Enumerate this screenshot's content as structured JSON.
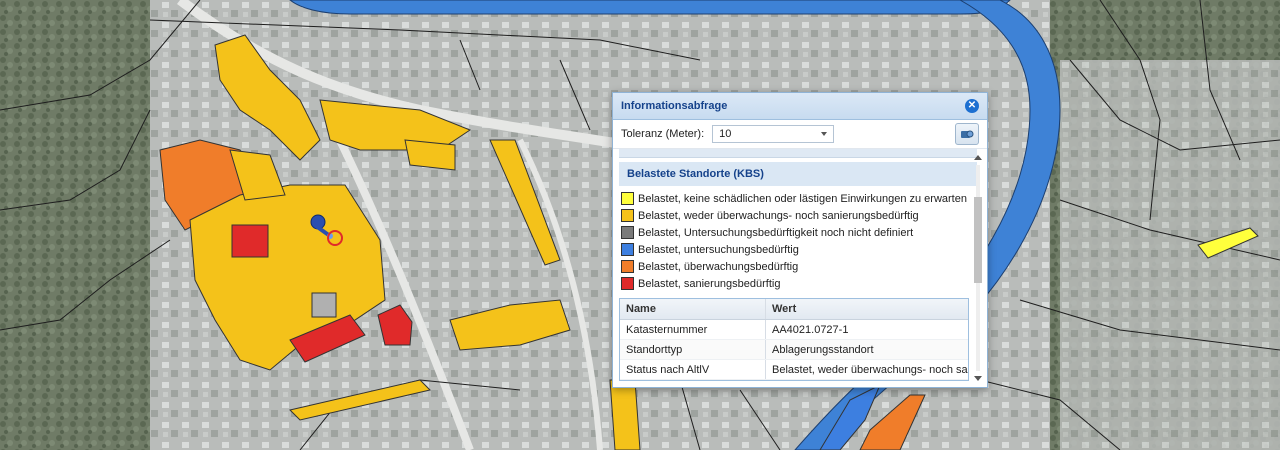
{
  "colors": {
    "river": "#3e82d6",
    "yellow": "#f6d21c",
    "orange_yellow": "#f4c21a",
    "grey": "#7a7a7a",
    "blue": "#3d7fe0",
    "orange": "#f07d2a",
    "red": "#e02a2a",
    "accent": "#15428b"
  },
  "dialog": {
    "title": "Informationsabfrage",
    "close_icon": "close-icon",
    "tolerance_label": "Toleranz (Meter):",
    "tolerance_value": "10",
    "tool_icon": "identify-tool-icon",
    "section_title": "Belastete Standorte (KBS)",
    "legend": [
      {
        "label": "Belastet, keine schädlichen oder lästigen Einwirkungen zu erwarten",
        "color": "#ffff3c"
      },
      {
        "label": "Belastet, weder überwachungs- noch sanierungsbedürftig",
        "color": "#f5c21b"
      },
      {
        "label": "Belastet, Untersuchungsbedürftigkeit noch nicht definiert",
        "color": "#7a7a7a"
      },
      {
        "label": "Belastet, untersuchungsbedürftig",
        "color": "#3d7fe0"
      },
      {
        "label": "Belastet, überwachungsbedürftig",
        "color": "#f07d2a"
      },
      {
        "label": "Belastet, sanierungsbedürftig",
        "color": "#e02a2a"
      }
    ],
    "table": {
      "headers": [
        "Name",
        "Wert"
      ],
      "rows": [
        [
          "Katasternummer",
          "AA4021.0727-1"
        ],
        [
          "Standorttyp",
          "Ablagerungsstandort"
        ],
        [
          "Status nach AltlV",
          "Belastet, weder überwachungs- noch sani..."
        ]
      ]
    }
  },
  "map": {
    "marker_icon": "pushpin-icon",
    "query_circle_icon": "query-circle-icon"
  }
}
